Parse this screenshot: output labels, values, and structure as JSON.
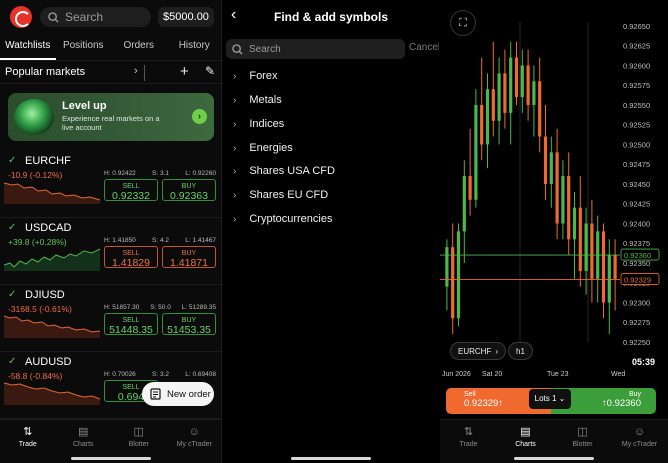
{
  "watchlist": {
    "search_placeholder": "Search",
    "balance": "$5000.00",
    "tabs": [
      "Watchlists",
      "Positions",
      "Orders",
      "History"
    ],
    "list_title": "Popular markets",
    "promo": {
      "title": "Level up",
      "subtitle": "Experience real markets on a live account"
    },
    "instruments": [
      {
        "symbol": "EURCHF",
        "change": "-10.9 (-0.12%)",
        "dir": "down",
        "high": "H: 0.92422",
        "spread": "S: 3.1",
        "low": "L: 0.92260",
        "sell_label": "SELL",
        "sell": "0.92332",
        "buy_label": "BUY",
        "buy": "0.92363"
      },
      {
        "symbol": "USDCAD",
        "change": "+39.8 (+0.28%)",
        "dir": "up",
        "high": "H: 1.41850",
        "spread": "S: 4.2",
        "low": "L: 1.41467",
        "sell_label": "SELL",
        "sell": "1.41829",
        "buy_label": "BUY",
        "buy": "1.41871"
      },
      {
        "symbol": "DJIUSD",
        "change": "-3168.5 (-0.61%)",
        "dir": "down",
        "high": "H: 51857.30",
        "spread": "S: 50.0",
        "low": "L: 51289.35",
        "sell_label": "SELL",
        "sell": "51448.35",
        "buy_label": "BUY",
        "buy": "51453.35"
      },
      {
        "symbol": "AUDUSD",
        "change": "-58.8 (-0.84%)",
        "dir": "down",
        "high": "H: 0.70026",
        "spread": "S: 3.2",
        "low": "L: 0.69408",
        "sell_label": "SELL",
        "sell": "0.694",
        "buy_label": "BUY",
        "buy": ""
      }
    ],
    "new_order": "New order",
    "nav": [
      "Trade",
      "Charts",
      "Blotter",
      "My cTrader"
    ]
  },
  "symbols": {
    "title": "Find & add symbols",
    "search_placeholder": "Search",
    "cancel": "Cancel",
    "categories": [
      "Forex",
      "Metals",
      "Indices",
      "Energies",
      "Shares USA CFD",
      "Shares EU CFD",
      "Cryptocurrencies"
    ]
  },
  "chart": {
    "symbol": "EURCHF",
    "timeframe": "h1",
    "time_label": "05:39",
    "dates": [
      "Jun 2026",
      "Sat 20",
      "Tue 23",
      "Wed"
    ],
    "sell_label": "Sell",
    "sell_price": "0.92329↑",
    "buy_label": "Buy",
    "buy_price": "↑0.92360",
    "lots": "Lots 1",
    "nav": [
      "Trade",
      "Charts",
      "Blotter",
      "My cTrader"
    ],
    "colors": {
      "up": "#4db84a",
      "down": "#f06a2f",
      "bid_line": "#f06a2f",
      "ask_line": "#4db84a"
    }
  },
  "chart_data": {
    "type": "candlestick",
    "y_tick_labels": [
      "0.92650",
      "0.92625",
      "0.92600",
      "0.92575",
      "0.92550",
      "0.92525",
      "0.92500",
      "0.92475",
      "0.92450",
      "0.92425",
      "0.92400",
      "0.92375",
      "0.92350",
      "0.92325",
      "0.92300",
      "0.92275",
      "0.92250"
    ],
    "ylim": [
      0.9225,
      0.92655
    ],
    "bid": 0.92329,
    "ask": 0.9236,
    "bid_label": "0.92329",
    "ask_label": "0.92360",
    "candles": [
      [
        0.9232,
        0.9238,
        0.9229,
        0.9237
      ],
      [
        0.9237,
        0.924,
        0.9226,
        0.9228
      ],
      [
        0.9228,
        0.924,
        0.9227,
        0.9239
      ],
      [
        0.9239,
        0.9248,
        0.9235,
        0.9246
      ],
      [
        0.9246,
        0.9252,
        0.9241,
        0.9243
      ],
      [
        0.9243,
        0.9257,
        0.9242,
        0.9255
      ],
      [
        0.9255,
        0.9261,
        0.9248,
        0.925
      ],
      [
        0.925,
        0.9259,
        0.9247,
        0.9257
      ],
      [
        0.9257,
        0.9263,
        0.9251,
        0.9253
      ],
      [
        0.9253,
        0.9261,
        0.925,
        0.9259
      ],
      [
        0.9259,
        0.9262,
        0.9252,
        0.9254
      ],
      [
        0.9254,
        0.9263,
        0.925,
        0.9261
      ],
      [
        0.9261,
        0.9263,
        0.9255,
        0.9256
      ],
      [
        0.9256,
        0.9262,
        0.9254,
        0.926
      ],
      [
        0.926,
        0.9262,
        0.9253,
        0.9255
      ],
      [
        0.9255,
        0.926,
        0.9251,
        0.9258
      ],
      [
        0.9258,
        0.9261,
        0.9249,
        0.9251
      ],
      [
        0.9251,
        0.9255,
        0.9243,
        0.9245
      ],
      [
        0.9245,
        0.9251,
        0.9242,
        0.9249
      ],
      [
        0.9249,
        0.9252,
        0.9238,
        0.924
      ],
      [
        0.924,
        0.9248,
        0.9238,
        0.9246
      ],
      [
        0.9246,
        0.9249,
        0.9236,
        0.9238
      ],
      [
        0.9238,
        0.9244,
        0.9233,
        0.9242
      ],
      [
        0.9242,
        0.9246,
        0.9232,
        0.9234
      ],
      [
        0.9234,
        0.9242,
        0.9231,
        0.924
      ],
      [
        0.924,
        0.9243,
        0.923,
        0.9233
      ],
      [
        0.9233,
        0.9241,
        0.923,
        0.9239
      ],
      [
        0.9239,
        0.924,
        0.9228,
        0.923
      ],
      [
        0.923,
        0.9238,
        0.9226,
        0.9236
      ],
      [
        0.9236,
        0.9238,
        0.9229,
        0.9233
      ]
    ]
  }
}
